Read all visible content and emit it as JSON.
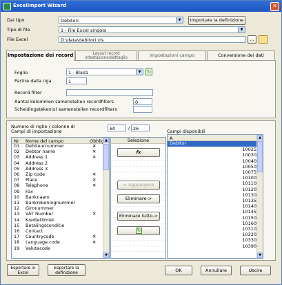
{
  "window": {
    "title": "ExcelImport Wizard",
    "close_glyph": "✕"
  },
  "top": {
    "dai_tipo_label": "Dai tipo",
    "dai_tipo_value": "Debitori",
    "importare_button": "Importare la definizione",
    "tipo_di_file_label": "Tipo di file",
    "tipo_di_file_value": "1 - File Excel singola",
    "file_excel_label": "File Excel",
    "file_excel_value": "D:\\data\\debitori.xls"
  },
  "tabs": [
    {
      "label": "Impostazione dei record"
    },
    {
      "label": "Layout record intestazione/dettaglio"
    },
    {
      "label": "Impostazioni campo"
    },
    {
      "label": "Conversione dei dati"
    }
  ],
  "record": {
    "foglio_label": "Foglio",
    "foglio_value": "1 - Blad1",
    "partire_label": "Partire dalla riga",
    "partire_value": "1",
    "filter_label": "Record filter",
    "filter_value": "",
    "aantal_label": "Aantal kolommen samenstellen recordfilters",
    "aantal_value": "0",
    "scheiding_label": "Scheidingsteken(s) samenstellen recordfilters",
    "scheiding_value": ""
  },
  "mapping": {
    "numero_label": "Numero di righe / colonne di",
    "campi_label": "Campi di importazione",
    "rows_value": "60",
    "separator": "/",
    "cols_value": "26",
    "headers": {
      "nr": "Nr",
      "name": "Nome del campo",
      "obbl": "Obblig"
    },
    "fields": [
      {
        "nr": "01",
        "name": "Debiteurnummer",
        "obbl": "✕"
      },
      {
        "nr": "02",
        "name": "Debtor name",
        "obbl": "✕"
      },
      {
        "nr": "03",
        "name": "Address 1",
        "obbl": "✕"
      },
      {
        "nr": "04",
        "name": "Address 2",
        "obbl": ""
      },
      {
        "nr": "05",
        "name": "Address 3",
        "obbl": ""
      },
      {
        "nr": "06",
        "name": "Zip code",
        "obbl": "✕"
      },
      {
        "nr": "07",
        "name": "Place",
        "obbl": "✕"
      },
      {
        "nr": "08",
        "name": "Telephone",
        "obbl": "✕"
      },
      {
        "nr": "09",
        "name": "Fax",
        "obbl": ""
      },
      {
        "nr": "10",
        "name": "Banknaam",
        "obbl": ""
      },
      {
        "nr": "11",
        "name": "Bankrekeningnummer",
        "obbl": ""
      },
      {
        "nr": "12",
        "name": "Gironummer",
        "obbl": ""
      },
      {
        "nr": "13",
        "name": "VAT Number",
        "obbl": "✕"
      },
      {
        "nr": "14",
        "name": "Kredietlimiet",
        "obbl": ""
      },
      {
        "nr": "15",
        "name": "Betalingsconditie",
        "obbl": ""
      },
      {
        "nr": "16",
        "name": "Contact",
        "obbl": ""
      },
      {
        "nr": "17",
        "name": "Countrycode",
        "obbl": "✕"
      },
      {
        "nr": "18",
        "name": "Language code",
        "obbl": "✕"
      },
      {
        "nr": "19",
        "name": "Valutacode",
        "obbl": ""
      }
    ],
    "selezione_header": "Selezione",
    "selezione_values": [
      "",
      "",
      "",
      "",
      "",
      "",
      "",
      "",
      "",
      "",
      "",
      "",
      "",
      "",
      "",
      "",
      "",
      "",
      ""
    ],
    "fx_label": "fx",
    "aggiungere_button": "<-Aggiungere",
    "eliminare_button": "Eliminare->",
    "eliminare_tutto_button": "Eliminare tutto->",
    "campi_disponibili_label": "Campi disponibili",
    "available_header": "A",
    "available": [
      "Debitor",
      "10025",
      "10030",
      "10040",
      "10050",
      "10075",
      "10100",
      "10110",
      "10120",
      "10130",
      "10135",
      "10140",
      "10145",
      "10150",
      "10160",
      "10310",
      "10320",
      "10330",
      "10390"
    ]
  },
  "footer": {
    "esportare_excel": "Esportare in Excel",
    "esportare_definizione": "Esportare la definizione",
    "ok": "OK",
    "annullare": "Annullare",
    "uscire": "Uscire"
  }
}
